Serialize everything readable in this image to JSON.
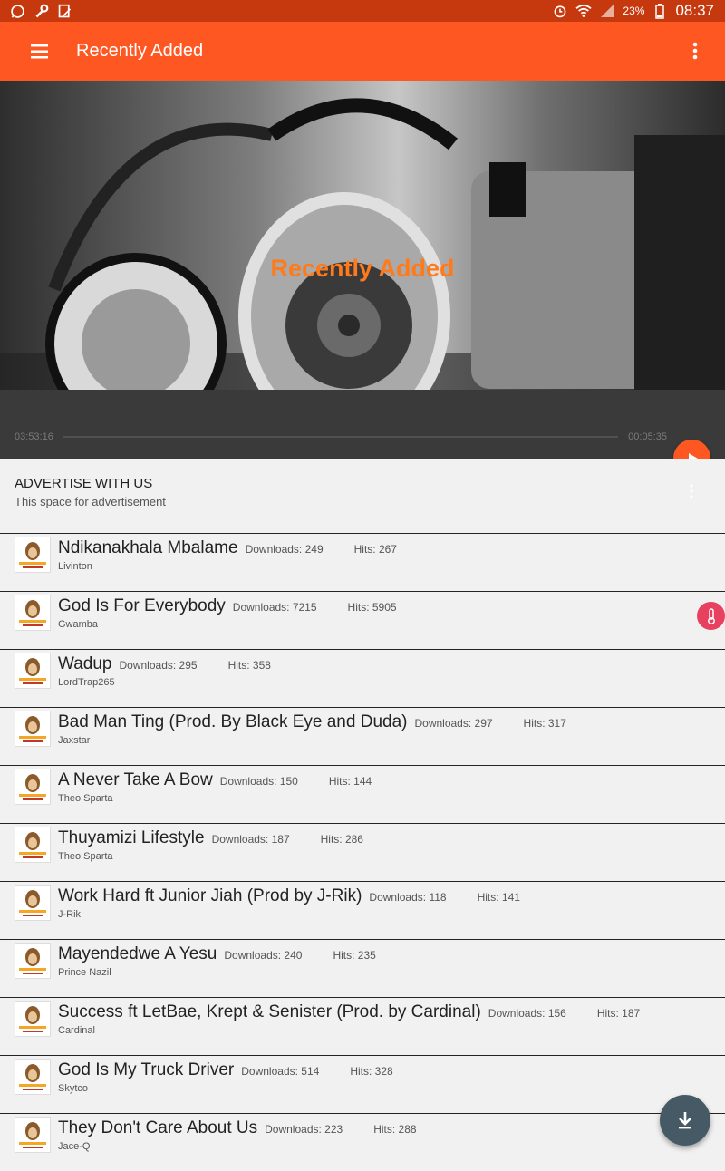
{
  "status_bar": {
    "battery": "23%",
    "time": "08:37"
  },
  "app_bar": {
    "title": "Recently Added"
  },
  "hero": {
    "title": "Recently Added"
  },
  "player": {
    "current_time": "03:53:16",
    "duration": "00:05:35"
  },
  "advert": {
    "title": "ADVERTISE WITH US",
    "subtitle": "This space for advertisement"
  },
  "songs": [
    {
      "title": "Ndikanakhala Mbalame",
      "artist": "Livinton",
      "downloads": "Downloads: 249",
      "hits": "Hits: 267"
    },
    {
      "title": "God Is For Everybody",
      "artist": "Gwamba",
      "downloads": "Downloads: 7215",
      "hits": "Hits: 5905"
    },
    {
      "title": "Wadup",
      "artist": "LordTrap265",
      "downloads": "Downloads: 295",
      "hits": "Hits: 358"
    },
    {
      "title": "Bad Man Ting (Prod. By Black Eye and Duda)",
      "artist": "Jaxstar",
      "downloads": "Downloads: 297",
      "hits": "Hits: 317"
    },
    {
      "title": "A Never Take A Bow",
      "artist": "Theo Sparta",
      "downloads": "Downloads: 150",
      "hits": "Hits: 144"
    },
    {
      "title": "Thuyamizi Lifestyle",
      "artist": "Theo Sparta",
      "downloads": "Downloads: 187",
      "hits": "Hits: 286"
    },
    {
      "title": "Work Hard ft Junior Jiah (Prod by J-Rik)",
      "artist": "J-Rik",
      "downloads": "Downloads: 118",
      "hits": "Hits: 141"
    },
    {
      "title": "Mayendedwe A Yesu",
      "artist": "Prince Nazil",
      "downloads": "Downloads: 240",
      "hits": "Hits: 235"
    },
    {
      "title": "Success ft LetBae, Krept & Senister (Prod. by Cardinal)",
      "artist": "Cardinal",
      "downloads": "Downloads: 156",
      "hits": "Hits: 187"
    },
    {
      "title": "God Is My Truck Driver",
      "artist": "Skytco",
      "downloads": "Downloads: 514",
      "hits": "Hits: 328"
    },
    {
      "title": "They Don't Care About Us",
      "artist": "Jace-Q",
      "downloads": "Downloads: 223",
      "hits": "Hits: 288"
    }
  ],
  "colors": {
    "accent": "#ff5722",
    "status_bar": "#c6390e",
    "fab": "#455a64",
    "hero_text": "#ff7a1a"
  },
  "icons": {
    "menu": "hamburger-icon",
    "overflow": "more-vert-icon",
    "play": "play-icon",
    "download": "download-icon",
    "temp": "thermometer-icon",
    "thumb": "artist-logo-icon"
  }
}
